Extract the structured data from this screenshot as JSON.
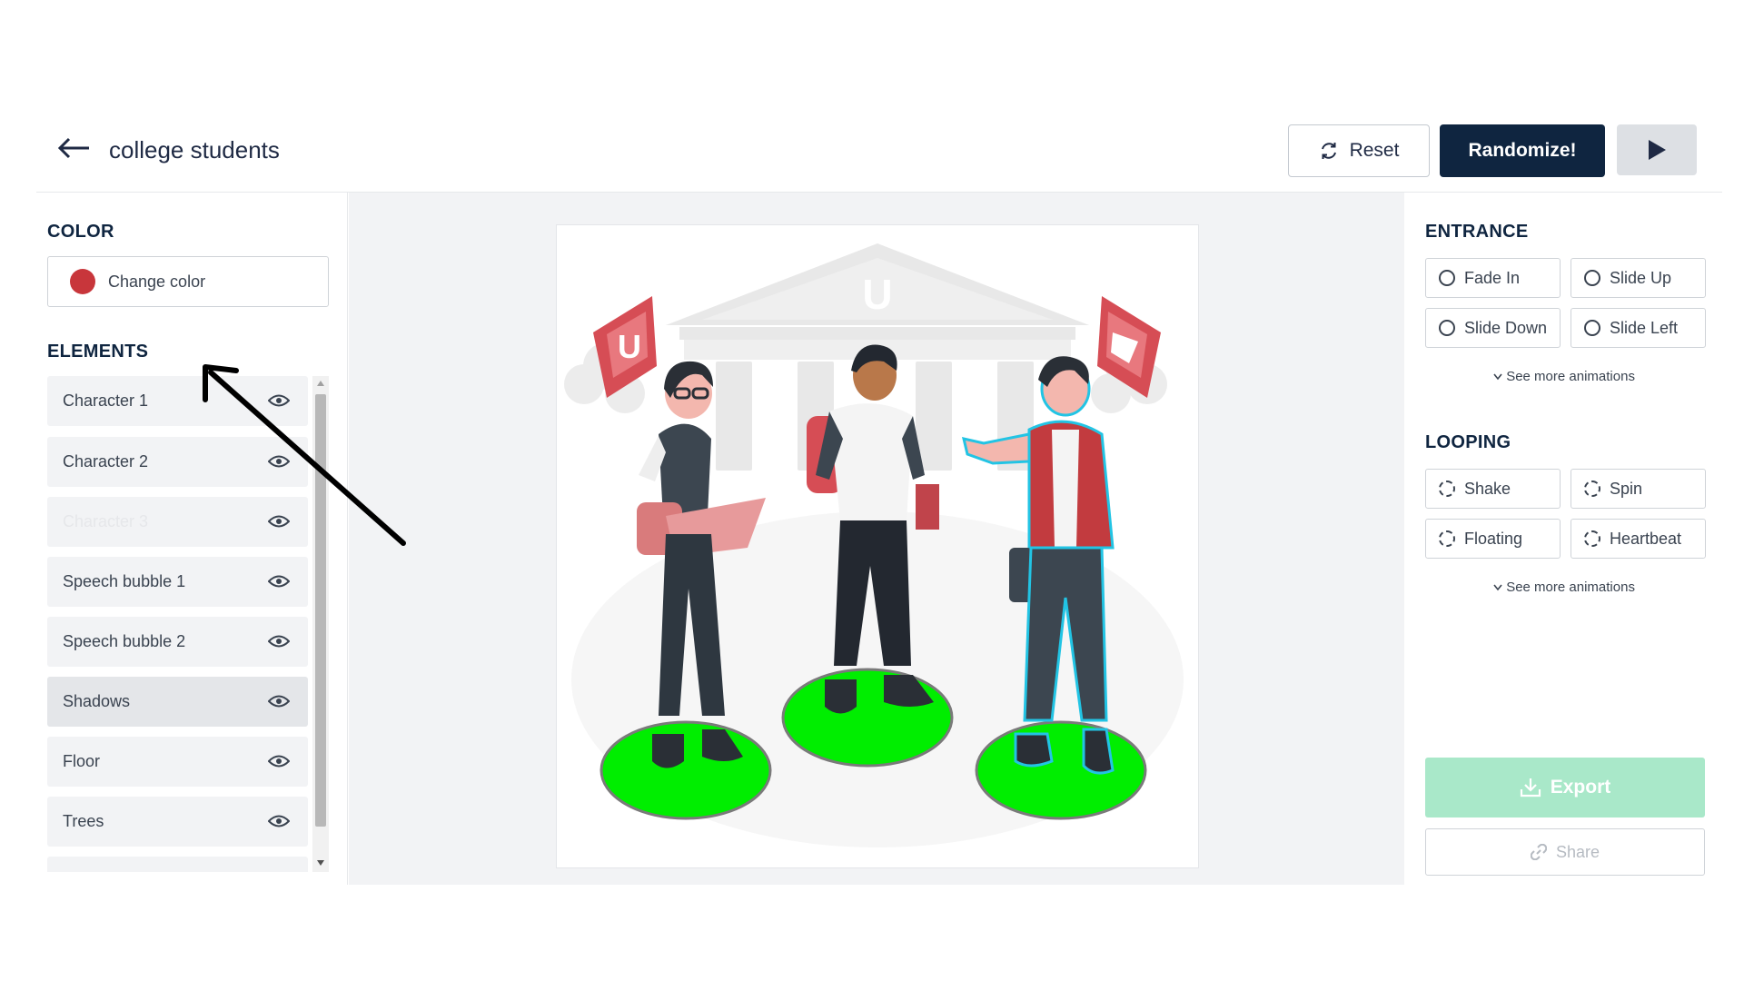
{
  "header": {
    "back_icon": "arrow-left-icon",
    "title": "college students",
    "reset_label": "Reset",
    "reset_icon": "refresh-icon",
    "randomize_label": "Randomize!",
    "play_icon": "play-icon"
  },
  "left_panel": {
    "color_title": "COLOR",
    "change_color_label": "Change color",
    "current_color": "#c8363b",
    "elements_title": "ELEMENTS",
    "elements": [
      {
        "label": "Character 1",
        "state": "visible"
      },
      {
        "label": "Character 2",
        "state": "visible"
      },
      {
        "label": "Character 3",
        "state": "dimmed"
      },
      {
        "label": "Speech bubble 1",
        "state": "visible"
      },
      {
        "label": "Speech bubble 2",
        "state": "visible"
      },
      {
        "label": "Shadows",
        "state": "active"
      },
      {
        "label": "Floor",
        "state": "visible"
      },
      {
        "label": "Trees",
        "state": "visible"
      }
    ]
  },
  "canvas": {
    "building_letter": "U",
    "bubble_left_letter": "U",
    "floor_disc_color": "#00ee00",
    "selection_outline_color": "#22c4e4"
  },
  "right_panel": {
    "entrance_title": "ENTRANCE",
    "entrance_options": [
      "Fade In",
      "Slide Up",
      "Slide Down",
      "Slide Left"
    ],
    "entrance_see_more": "See more animations",
    "looping_title": "LOOPING",
    "looping_options": [
      "Shake",
      "Spin",
      "Floating",
      "Heartbeat"
    ],
    "looping_see_more": "See more animations",
    "export_label": "Export",
    "export_icon": "download-icon",
    "share_label": "Share",
    "share_icon": "link-icon",
    "accent_color": "#a9e8c9"
  }
}
